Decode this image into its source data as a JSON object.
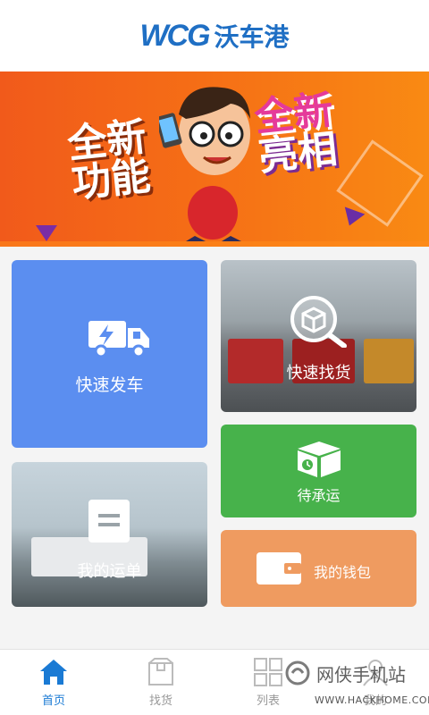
{
  "header": {
    "logo_mark": "WCG",
    "logo_text": "沃车港"
  },
  "banner": {
    "left_line1": "全新",
    "left_line2": "功能",
    "right_line1": "全新",
    "right_line2": "亮相"
  },
  "tiles": {
    "fast_dispatch": {
      "label": "快速发车",
      "icon": "truck-lightning-icon",
      "color": "#5b8ef0"
    },
    "find_cargo": {
      "label": "快速找货",
      "icon": "box-search-icon"
    },
    "pending": {
      "label": "待承运",
      "icon": "box-clock-icon",
      "color": "#47b24b"
    },
    "waybill": {
      "label": "我的运单",
      "icon": "document-icon"
    },
    "wallet": {
      "label": "我的钱包",
      "icon": "wallet-icon",
      "color": "#ef9b60"
    }
  },
  "nav": {
    "items": [
      {
        "label": "首页",
        "icon": "home-icon",
        "active": true
      },
      {
        "label": "找货",
        "icon": "box-icon",
        "active": false
      },
      {
        "label": "列表",
        "icon": "grid-icon",
        "active": false
      },
      {
        "label": "我的",
        "icon": "user-icon",
        "active": false
      }
    ],
    "active_color": "#1a7ad4"
  },
  "watermark": {
    "text": "网侠手机站",
    "url": "WWW.HACKHOME.COM"
  }
}
